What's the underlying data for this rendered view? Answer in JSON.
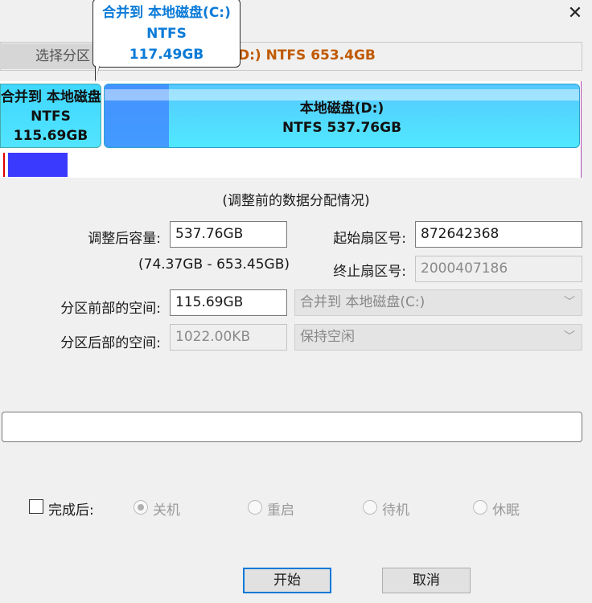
{
  "window": {
    "close_label": "✕"
  },
  "tooltip": {
    "line1": "合并到 本地磁盘(C:)",
    "line2": "NTFS",
    "line3": "117.49GB"
  },
  "selector": {
    "button_label": "选择分区",
    "info_text": "D:) NTFS 653.4GB"
  },
  "disk_map": {
    "partition_c": {
      "line1": "合并到 本地磁盘(C:)",
      "line2": "NTFS",
      "line3": "115.69GB"
    },
    "partition_d": {
      "line1": "本地磁盘(D:)",
      "line2": "NTFS 537.76GB"
    }
  },
  "caption": "(调整前的数据分配情况)",
  "form": {
    "size_label": "调整后容量:",
    "size_value": "537.76GB",
    "size_range": "(74.37GB - 653.45GB)",
    "start_sector_label": "起始扇区号:",
    "start_sector_value": "872642368",
    "end_sector_label": "终止扇区号:",
    "end_sector_value": "2000407186",
    "front_space_label": "分区前部的空间:",
    "front_space_value": "115.69GB",
    "front_space_option": "合并到 本地磁盘(C:)",
    "back_space_label": "分区后部的空间:",
    "back_space_value": "1022.00KB",
    "back_space_option": "保持空闲"
  },
  "after_complete": {
    "checkbox_label": "完成后:",
    "options": [
      "关机",
      "重启",
      "待机",
      "休眠"
    ],
    "selected": "关机"
  },
  "buttons": {
    "start": "开始",
    "cancel": "取消"
  }
}
